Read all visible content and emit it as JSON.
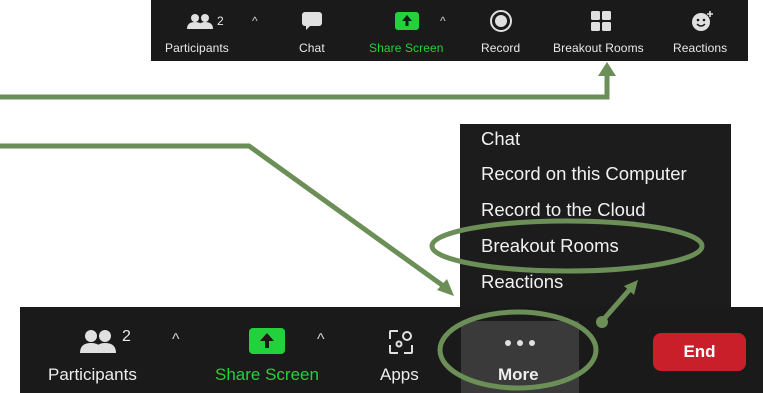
{
  "top_toolbar": {
    "participants": {
      "label": "Participants",
      "count": "2"
    },
    "chat": {
      "label": "Chat"
    },
    "share_screen": {
      "label": "Share Screen"
    },
    "record": {
      "label": "Record"
    },
    "breakout_rooms": {
      "label": "Breakout Rooms"
    },
    "reactions": {
      "label": "Reactions"
    }
  },
  "more_menu": {
    "items": [
      {
        "label": "Chat"
      },
      {
        "label": "Record on this Computer"
      },
      {
        "label": "Record to the Cloud"
      },
      {
        "label": "Breakout Rooms"
      },
      {
        "label": "Reactions"
      }
    ]
  },
  "bottom_toolbar": {
    "participants": {
      "label": "Participants",
      "count": "2"
    },
    "share_screen": {
      "label": "Share Screen"
    },
    "apps": {
      "label": "Apps"
    },
    "more": {
      "label": "More"
    },
    "end": {
      "label": "End"
    }
  },
  "colors": {
    "toolbar_bg": "#1a1a1a",
    "share_green": "#22d13c",
    "end_red": "#c81f2a",
    "annotation_green": "#6b8f57"
  },
  "icons": {
    "participants": "participants-icon",
    "chat": "chat-bubble-icon",
    "share_screen": "share-screen-arrow-icon",
    "record": "record-icon",
    "breakout_rooms": "breakout-rooms-grid-icon",
    "reactions": "smiley-plus-icon",
    "apps": "apps-icon",
    "more": "ellipsis-icon",
    "caret": "caret-up-icon"
  }
}
